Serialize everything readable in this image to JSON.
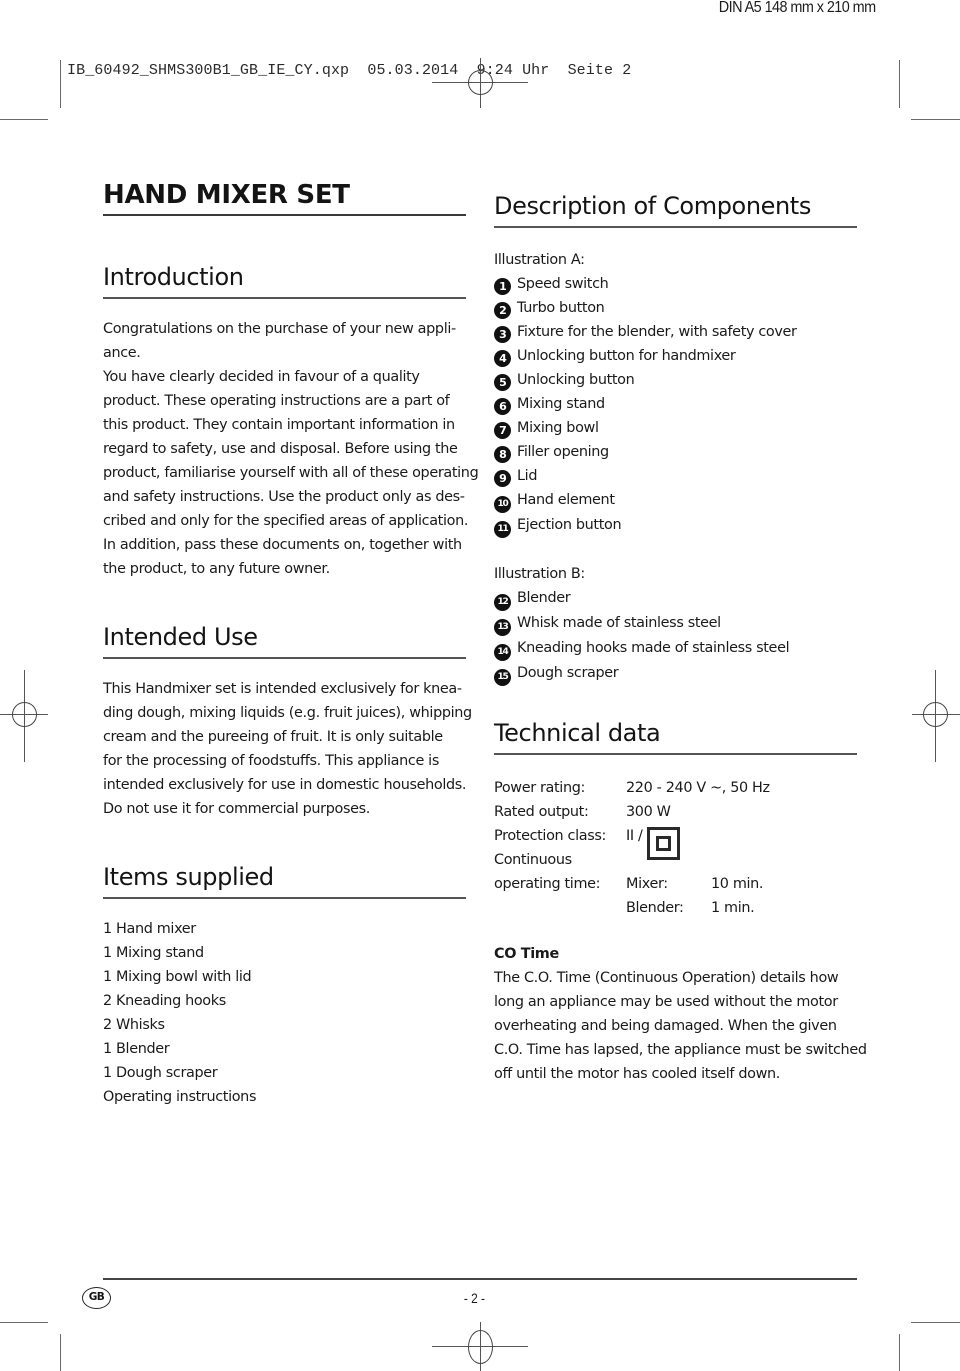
{
  "print_meta": {
    "format_label": "DIN A5 148 mm x 210 mm",
    "slug_line": "IB_60492_SHMS300B1_GB_IE_CY.qxp  05.03.2014  9:24 Uhr  Seite 2"
  },
  "left": {
    "doc_title": "HAND MIXER SET",
    "introduction": {
      "heading": "Introduction",
      "lines": [
        "Congratulations on the purchase of your new appli-",
        "ance.",
        "You have clearly decided in favour of a quality",
        "product. These operating instructions are a part of",
        "this product. They contain important information in",
        "regard to safety, use and disposal. Before using the",
        "product, familiarise yourself with all of these operating",
        "and safety instructions. Use the product only as des-",
        "cribed and only for the specified areas of application.",
        "In addition, pass these documents on, together with",
        "the product, to any future owner."
      ]
    },
    "intended_use": {
      "heading": "Intended Use",
      "lines": [
        "This Handmixer set is intended exclusively for knea-",
        "ding dough, mixing liquids (e.g. fruit juices), whipping",
        "cream and the pureeing of fruit. It is only suitable",
        "for the processing of foodstuffs. This appliance is",
        "intended exclusively for use in domestic households.",
        "Do not use it for commercial purposes."
      ]
    },
    "items_supplied": {
      "heading": "Items supplied",
      "items": [
        "1 Hand mixer",
        "1 Mixing stand",
        "1 Mixing bowl with lid",
        "2 Kneading hooks",
        "2 Whisks",
        "1 Blender",
        "1 Dough scraper",
        "Operating instructions"
      ]
    }
  },
  "right": {
    "components": {
      "heading": "Description of Components",
      "illustration_a": {
        "label": "Illustration A:",
        "items": [
          {
            "num": "1",
            "text": "Speed switch"
          },
          {
            "num": "2",
            "text": "Turbo button"
          },
          {
            "num": "3",
            "text": "Fixture for the blender, with safety cover"
          },
          {
            "num": "4",
            "text": "Unlocking button for handmixer"
          },
          {
            "num": "5",
            "text": "Unlocking button"
          },
          {
            "num": "6",
            "text": "Mixing stand"
          },
          {
            "num": "7",
            "text": "Mixing bowl"
          },
          {
            "num": "8",
            "text": "Filler opening"
          },
          {
            "num": "9",
            "text": "Lid"
          },
          {
            "num": "10",
            "text": "Hand element"
          },
          {
            "num": "11",
            "text": "Ejection button"
          }
        ]
      },
      "illustration_b": {
        "label": "Illustration B:",
        "items": [
          {
            "num": "12",
            "text": "Blender"
          },
          {
            "num": "13",
            "text": "Whisk made of stainless steel"
          },
          {
            "num": "14",
            "text": "Kneading hooks made of stainless steel"
          },
          {
            "num": "15",
            "text": "Dough scraper"
          }
        ]
      }
    },
    "technical_data": {
      "heading": "Technical data",
      "power_rating_label": "Power rating:",
      "power_rating_value": "220 - 240 V ~, 50 Hz",
      "rated_output_label": "Rated output:",
      "rated_output_value": "300 W",
      "protection_class_label": "Protection class:",
      "protection_class_value": "II /",
      "protection_class_icon": "double-insulation-square-icon",
      "continuous_label_1": "Continuous",
      "continuous_label_2": "operating time:",
      "mixer_label": "Mixer:",
      "mixer_value": "10 min.",
      "blender_label": "Blender:",
      "blender_value": "1 min."
    },
    "co_time": {
      "heading": "CO Time",
      "lines": [
        "The C.O. Time (Continuous Operation) details how",
        "long an appliance may be used without the motor",
        "overheating and being damaged. When the given",
        "C.O. Time has lapsed, the appliance must be switched",
        "off until the motor has cooled itself down."
      ]
    }
  },
  "footer": {
    "country_badge": "GB",
    "page_number": "- 2 -"
  }
}
